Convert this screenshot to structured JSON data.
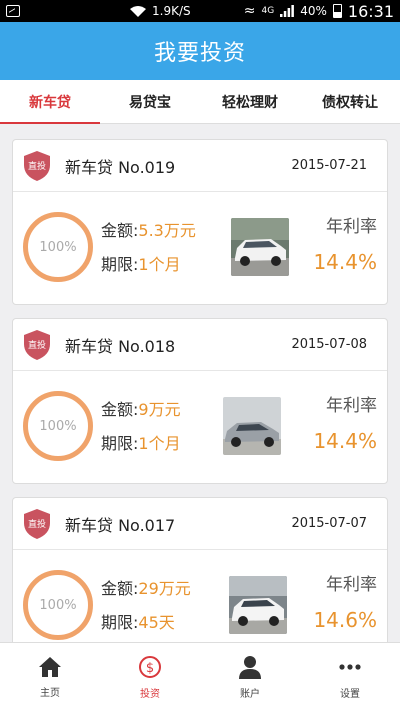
{
  "status_bar": {
    "speed": "1.9K/S",
    "network": "4G",
    "battery": "40%",
    "time": "16:31"
  },
  "app": {
    "title": "我要投资"
  },
  "tabs": [
    {
      "label": "新车贷",
      "active": true
    },
    {
      "label": "易贷宝",
      "active": false
    },
    {
      "label": "轻松理财",
      "active": false
    },
    {
      "label": "债权转让",
      "active": false
    }
  ],
  "loans": [
    {
      "badge": "直投",
      "title": "新车贷 No.019",
      "date": "2015-07-21",
      "progress": "100%",
      "amount_label": "金额:",
      "amount": "5.3万元",
      "term_label": "期限:",
      "term": "1个月",
      "rate_label": "年利率",
      "rate": "14.4%",
      "car": "white-suv"
    },
    {
      "badge": "直投",
      "title": "新车贷 No.018",
      "date": "2015-07-08",
      "progress": "100%",
      "amount_label": "金额:",
      "amount": "9万元",
      "term_label": "期限:",
      "term": "1个月",
      "rate_label": "年利率",
      "rate": "14.4%",
      "car": "silver-sedan"
    },
    {
      "badge": "直投",
      "title": "新车贷 No.017",
      "date": "2015-07-07",
      "progress": "100%",
      "amount_label": "金额:",
      "amount": "29万元",
      "term_label": "期限:",
      "term": "45天",
      "rate_label": "年利率",
      "rate": "14.6%",
      "car": "white-suv"
    }
  ],
  "bottom_nav": [
    {
      "label": "主页",
      "icon": "home-icon",
      "active": false
    },
    {
      "label": "投资",
      "icon": "invest-icon",
      "active": true
    },
    {
      "label": "账户",
      "icon": "user-icon",
      "active": false
    },
    {
      "label": "设置",
      "icon": "more-icon",
      "active": false
    }
  ],
  "colors": {
    "primary": "#3aa6e8",
    "accent_red": "#d9383c",
    "orange": "#e8932e",
    "ring": "#f0a36a"
  }
}
